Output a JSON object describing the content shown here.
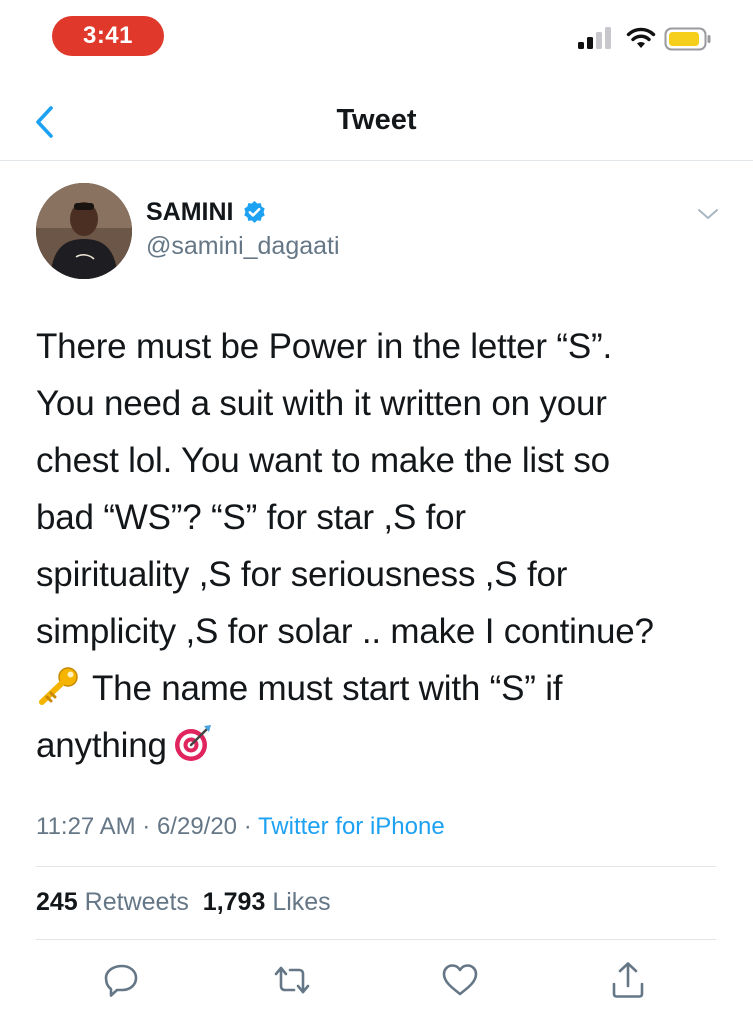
{
  "status_bar": {
    "time": "3:41"
  },
  "nav": {
    "title": "Tweet"
  },
  "author": {
    "name": "SAMINI",
    "handle": "@samini_dagaati",
    "verified": true
  },
  "tweet": {
    "lines": [
      "There must be Power in the letter “S”.",
      "You need a suit with it written on your",
      "chest lol. You want to make the list so",
      "bad “WS”?  “S” for star ,S for",
      "spirituality ,S for seriousness ,S for",
      "simplicity ,S for solar .. make I continue?",
      "The name must start with “S” if",
      "anything"
    ],
    "emoji": [
      "key-emoji",
      "direct-hit-emoji"
    ]
  },
  "meta": {
    "time": "11:27 AM",
    "separator": " · ",
    "date": "6/29/20",
    "source": "Twitter for iPhone"
  },
  "stats": {
    "retweets_count": "245",
    "retweets_label": "Retweets",
    "likes_count": "1,793",
    "likes_label": "Likes"
  },
  "colors": {
    "accent": "#1da1f2",
    "time_pill": "#e0392b",
    "secondary_text": "#657786"
  },
  "icons": {
    "back": "chevron-left-icon",
    "menu": "chevron-down-icon",
    "reply": "reply-icon",
    "retweet": "retweet-icon",
    "like": "heart-icon",
    "share": "share-icon"
  }
}
